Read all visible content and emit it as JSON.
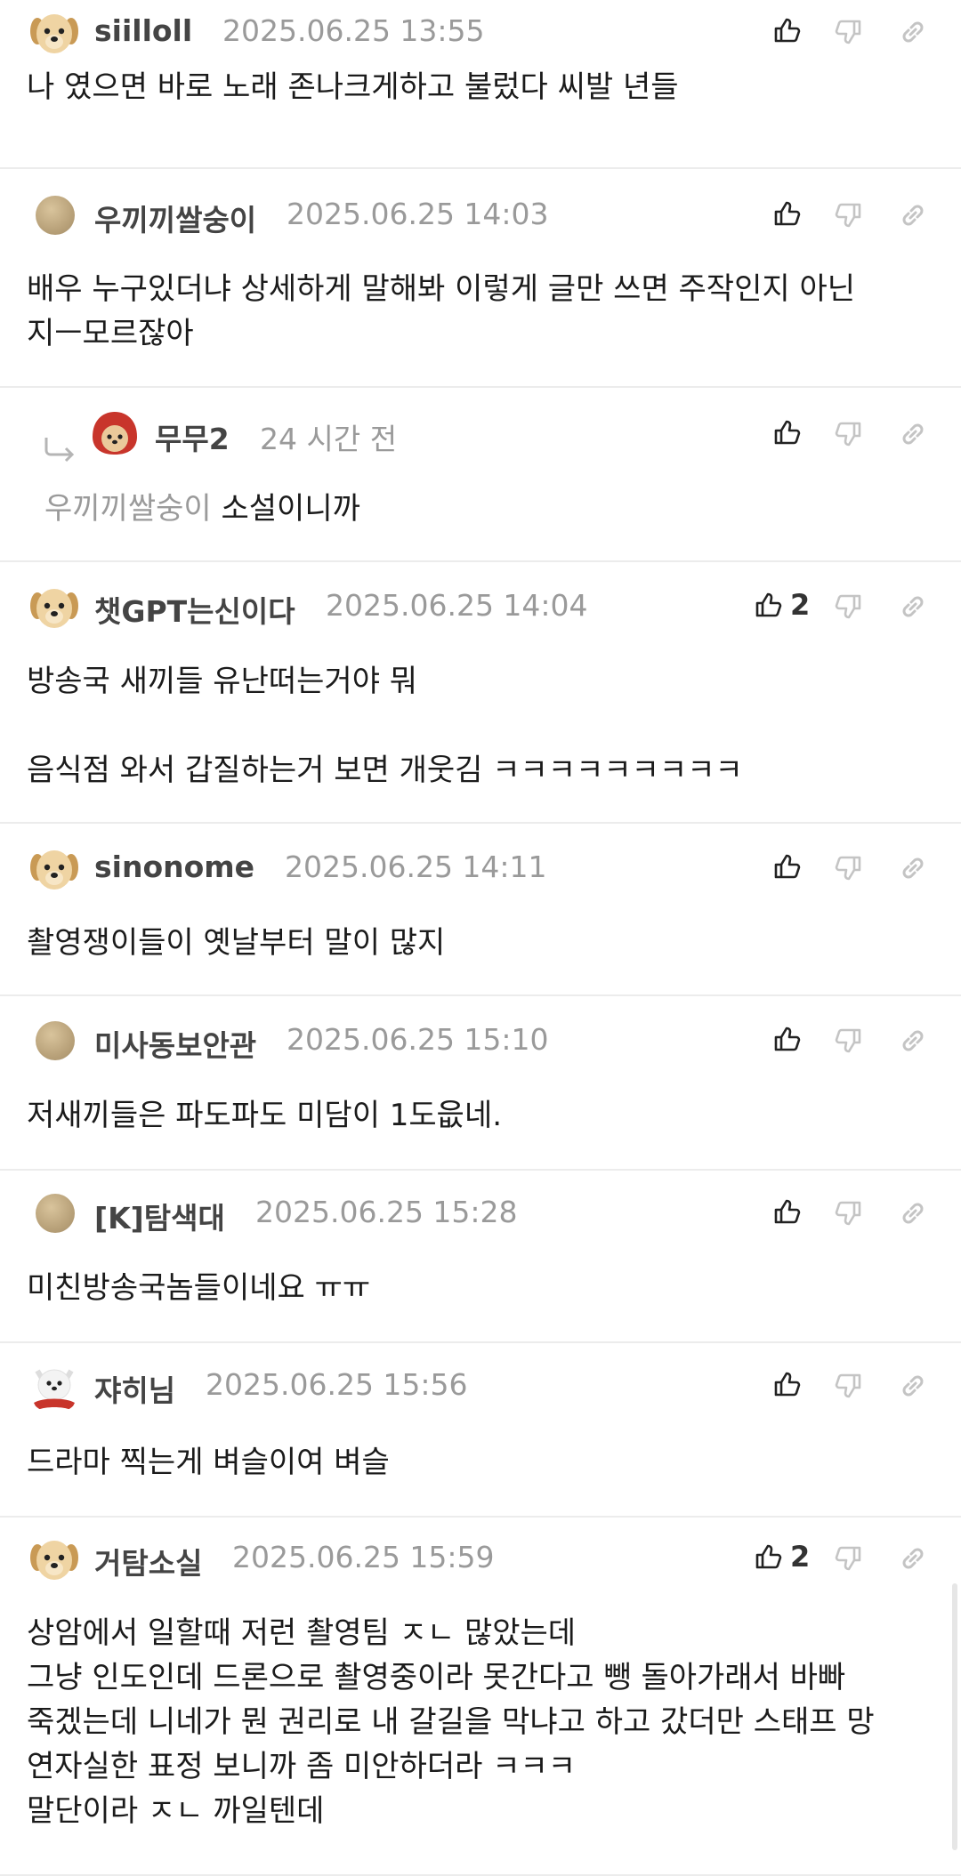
{
  "comments": [
    {
      "name": "siilloll",
      "date": "2025.06.25 13:55",
      "likes": "",
      "avatar": "puppy-avatar",
      "lines": [
        "나 였으면 바로 노래 존나크게하고 불렀다 씨발 년들"
      ]
    },
    {
      "name": "우끼끼쌀숭이",
      "date": "2025.06.25 14:03",
      "likes": "",
      "avatar": "beige-dot-avatar",
      "lines": [
        "배우 누구있더냐 상세하게 말해봐 이렇게 글만 쓰면 주작인지 아닌",
        "지ㅡ모르잖아"
      ]
    },
    {
      "name": "무무2",
      "date": "24 시간 전",
      "likes": "",
      "avatar": "red-hood-puppy-avatar",
      "mention": "우끼끼쌀숭이",
      "lines": [
        "소설이니까"
      ]
    },
    {
      "name": "챗GPT는신이다",
      "date": "2025.06.25 14:04",
      "likes": "2",
      "avatar": "puppy-avatar",
      "lines": [
        "방송국 새끼들 유난떠는거야 뭐",
        "",
        "음식점 와서 갑질하는거 보면 개웃김 ㅋㅋㅋㅋㅋㅋㅋㅋㅋ"
      ]
    },
    {
      "name": "sinonome",
      "date": "2025.06.25 14:11",
      "likes": "",
      "avatar": "puppy-avatar",
      "lines": [
        "촬영쟁이들이 옛날부터 말이 많지"
      ]
    },
    {
      "name": "미사동보안관",
      "date": "2025.06.25 15:10",
      "likes": "",
      "avatar": "beige-dot-avatar",
      "lines": [
        "저새끼들은 파도파도 미담이 1도읎네."
      ]
    },
    {
      "name": "[K]탐색대",
      "date": "2025.06.25 15:28",
      "likes": "",
      "avatar": "beige-dot-avatar",
      "lines": [
        "미친방송국놈들이네요 ㅠㅠ"
      ]
    },
    {
      "name": "쟈히님",
      "date": "2025.06.25 15:56",
      "likes": "",
      "avatar": "white-dog-avatar",
      "lines": [
        "드라마 찍는게 벼슬이여 벼슬"
      ]
    },
    {
      "name": "거탐소실",
      "date": "2025.06.25 15:59",
      "likes": "2",
      "avatar": "puppy-avatar",
      "lines": [
        "상암에서 일할때 저런 촬영팀 ㅈㄴ 많았는데",
        "그냥 인도인데 드론으로 촬영중이라 못간다고 뺑 돌아가래서 바빠",
        "죽겠는데 니네가 뭔 권리로 내 갈길을 막냐고 하고 갔더만 스태프 망",
        "연자실한 표정 보니까 좀 미안하더라 ㅋㅋㅋ",
        "말단이라 ㅈㄴ 까일텐데"
      ]
    }
  ],
  "icons": {
    "like": "thumbs-up-icon",
    "dislike": "thumbs-down-icon",
    "link": "link-icon",
    "reply": "reply-arrow-icon"
  },
  "colors": {
    "name": "#444444",
    "date": "#9a9a9a",
    "divider": "#ececec",
    "mention": "#9a9a9a"
  }
}
